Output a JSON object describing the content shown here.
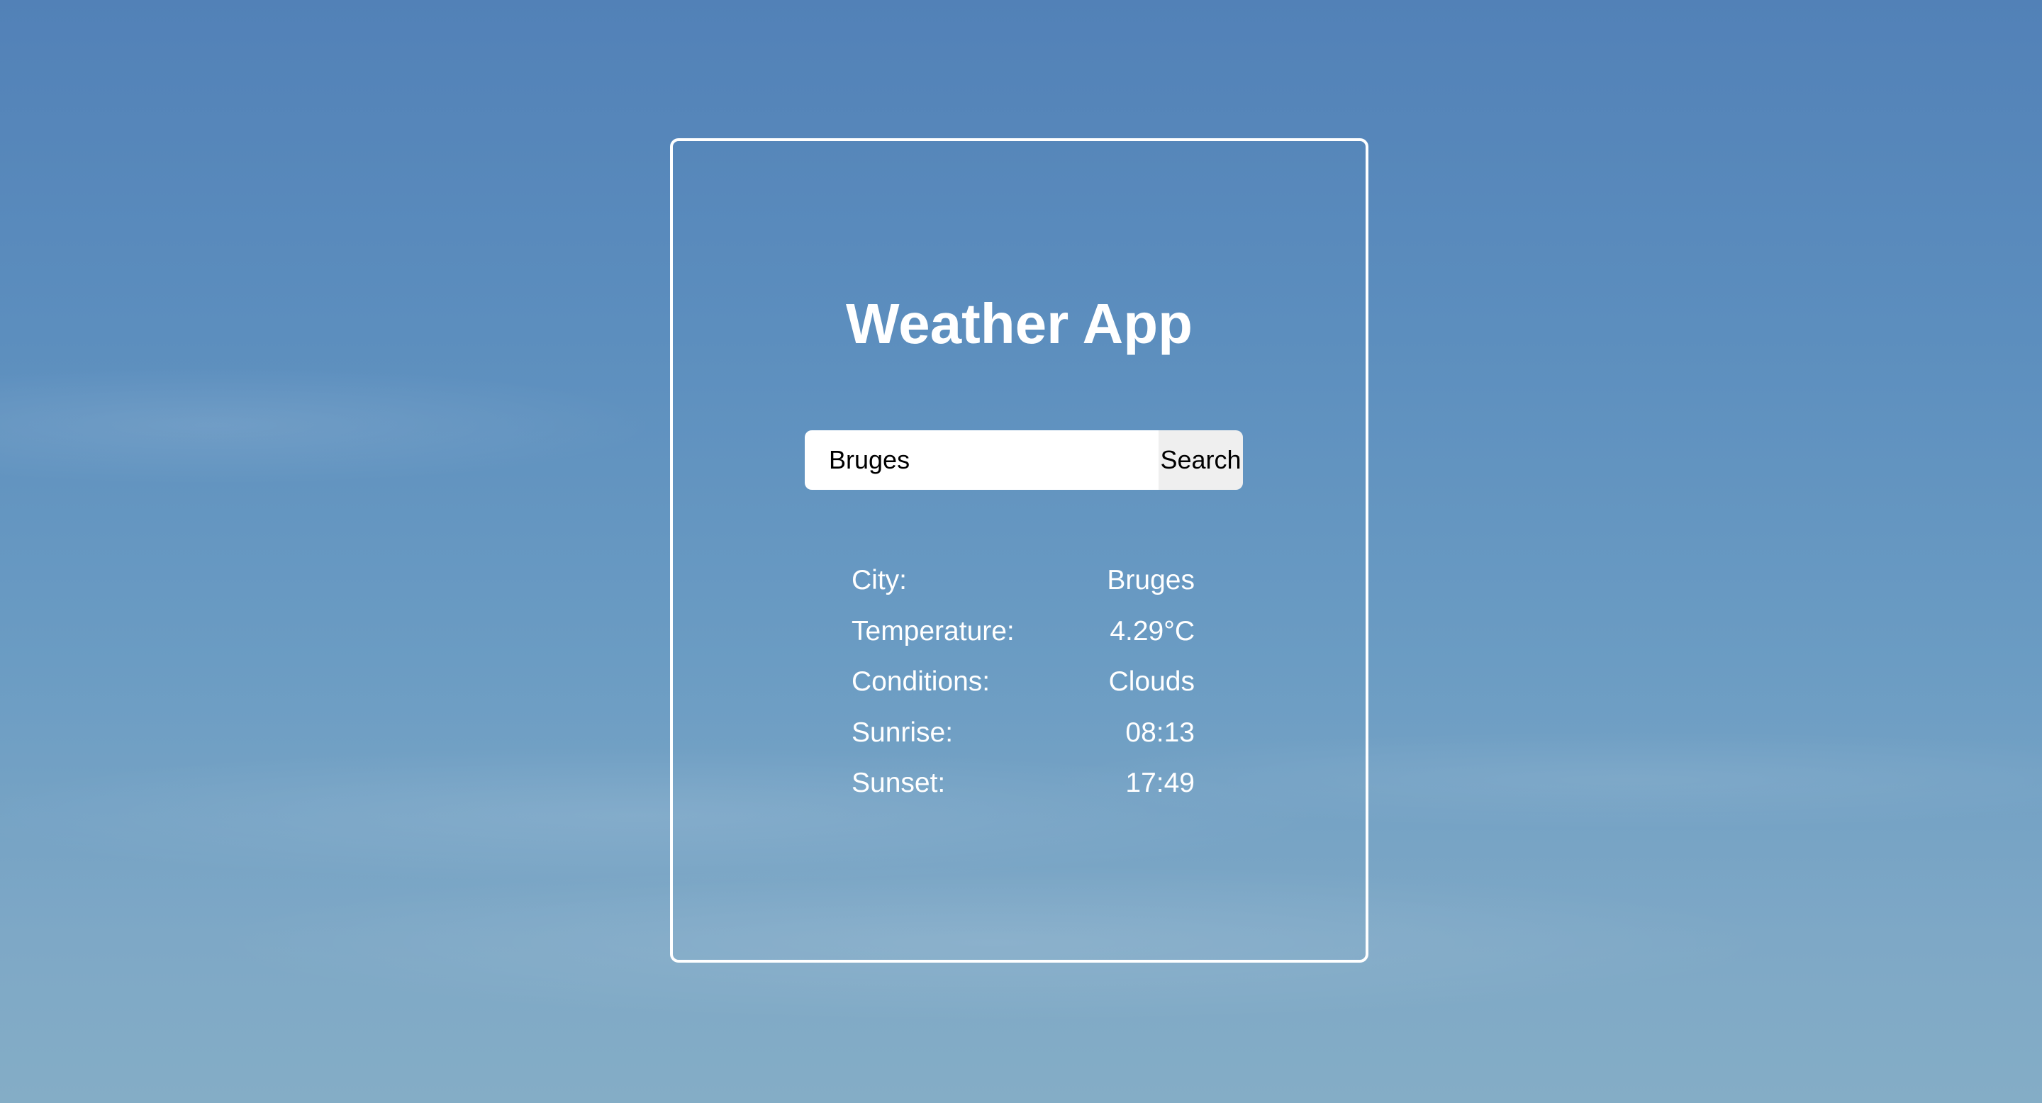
{
  "app": {
    "title": "Weather App"
  },
  "search": {
    "value": "Bruges",
    "button_label": "Search"
  },
  "weather": {
    "rows": [
      {
        "label": "City:",
        "value": "Bruges"
      },
      {
        "label": "Temperature:",
        "value": "4.29°C"
      },
      {
        "label": "Conditions:",
        "value": "Clouds"
      },
      {
        "label": "Sunrise:",
        "value": "08:13"
      },
      {
        "label": "Sunset:",
        "value": "17:49"
      }
    ]
  },
  "colors": {
    "text": "#ffffff",
    "card_border": "#ffffff",
    "sky_top": "#5281b7",
    "sky_bottom": "#84adc6",
    "button_bg": "#efefef"
  }
}
